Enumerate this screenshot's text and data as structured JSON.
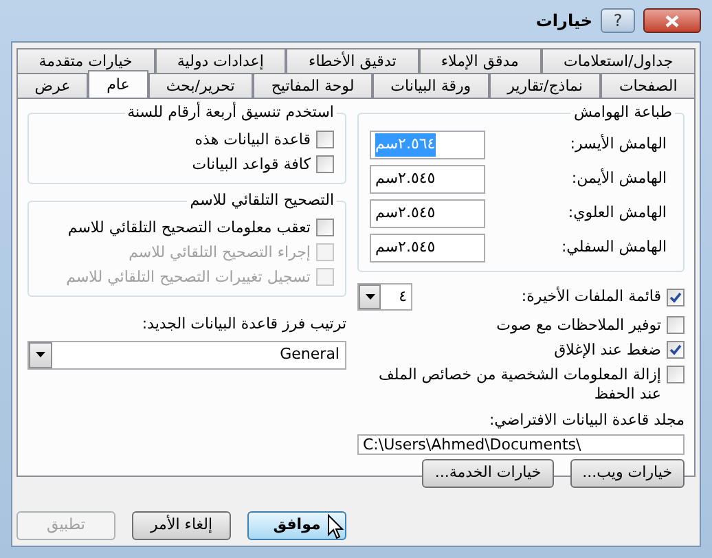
{
  "window": {
    "title": "خيارات",
    "help": "?"
  },
  "tab_rows": [
    {
      "tabs": [
        {
          "label": "جداول/استعلامات",
          "selected": false
        },
        {
          "label": "مدقق الإملاء",
          "selected": false
        },
        {
          "label": "تدقيق الأخطاء",
          "selected": false
        },
        {
          "label": "إعدادات دولية",
          "selected": false
        },
        {
          "label": "خيارات متقدمة",
          "selected": false
        }
      ]
    },
    {
      "tabs": [
        {
          "label": "الصفحات",
          "selected": false
        },
        {
          "label": "نماذج/تقارير",
          "selected": false
        },
        {
          "label": "ورقة البيانات",
          "selected": false
        },
        {
          "label": "لوحة المفاتيح",
          "selected": false
        },
        {
          "label": "تحرير/بحث",
          "selected": false
        },
        {
          "label": "عام",
          "selected": true
        },
        {
          "label": "عرض",
          "selected": false
        }
      ]
    }
  ],
  "margins": {
    "title": "طباعة الهوامش",
    "fields": [
      {
        "label": "الهامش الأيسر:",
        "value": "٢.٥٦٤سم",
        "text_selected": true
      },
      {
        "label": "الهامش الأيمن:",
        "value": "٢.٥٤٥سم",
        "text_selected": false
      },
      {
        "label": "الهامش العلوي:",
        "value": "٢.٥٤٥سم",
        "text_selected": false
      },
      {
        "label": "الهامش السفلي:",
        "value": "٢.٥٤٥سم",
        "text_selected": false
      }
    ]
  },
  "recent_files": {
    "label": "قائمة الملفات الأخيرة:",
    "checked": true,
    "value": "٤"
  },
  "options": [
    {
      "label": "توفير الملاحظات مع صوت",
      "checked": false
    },
    {
      "label": "ضغط عند الإغلاق",
      "checked": true
    },
    {
      "label": "إزالة المعلومات الشخصية من خصائص الملف عند الحفظ",
      "checked": false
    }
  ],
  "default_folder": {
    "label": "مجلد قاعدة البيانات الافتراضي:",
    "value": "C:\\Users\\Ahmed\\Documents\\"
  },
  "service_buttons": [
    "خيارات ويب...",
    "خيارات الخدمة..."
  ],
  "year_format": {
    "title": "استخدم تنسيق أربعة أرقام للسنة",
    "options": [
      {
        "label": "قاعدة البيانات هذه",
        "checked": false,
        "disabled": false
      },
      {
        "label": "كافة قواعد البيانات",
        "checked": false,
        "disabled": false
      }
    ]
  },
  "autocorrect": {
    "title": "التصحيح التلقائي للاسم",
    "options": [
      {
        "label": "تعقب معلومات التصحيح التلقائي للاسم",
        "checked": false,
        "disabled": false
      },
      {
        "label": "إجراء التصحيح التلقائي للاسم",
        "checked": false,
        "disabled": true
      },
      {
        "label": "تسجيل تغييرات التصحيح التلقائي للاسم",
        "checked": false,
        "disabled": true
      }
    ]
  },
  "sort_order": {
    "label": "ترتيب فرز قاعدة البيانات الجديد:",
    "value": "General"
  },
  "buttons": [
    {
      "label": "موافق",
      "kind": "default",
      "disabled": false
    },
    {
      "label": "إلغاء الأمر",
      "kind": "normal",
      "disabled": false
    },
    {
      "label": "تطبيق",
      "kind": "normal",
      "disabled": true
    }
  ]
}
